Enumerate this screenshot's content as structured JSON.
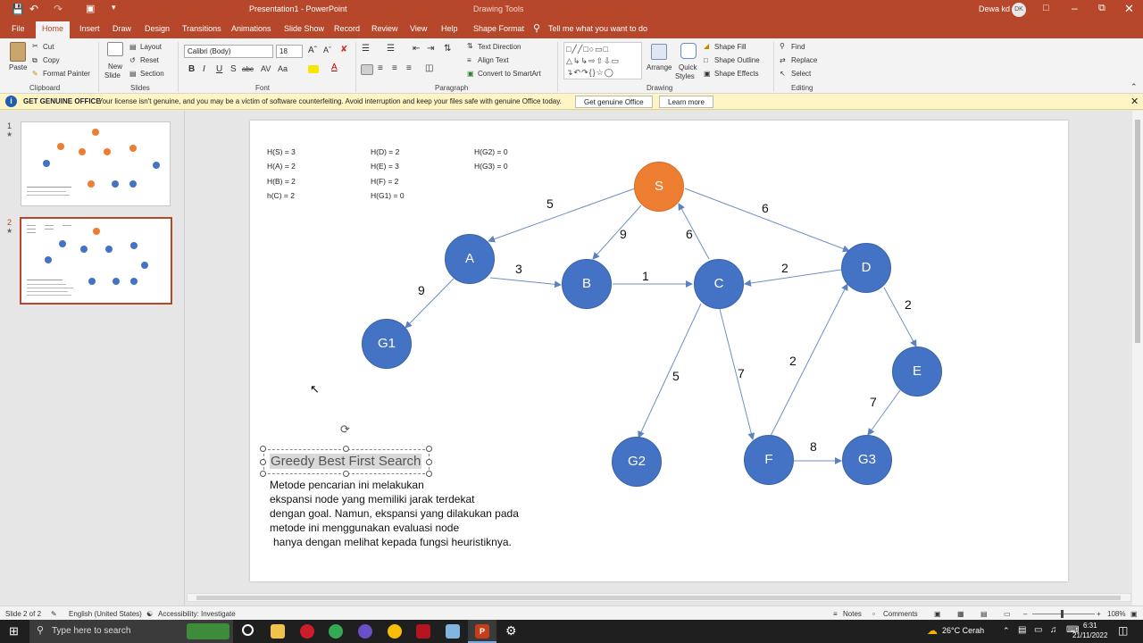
{
  "titlebar": {
    "title": "Presentation1  -  PowerPoint",
    "context": "Drawing Tools",
    "user": "Dewa kd",
    "initials": "DK"
  },
  "tabs": [
    "File",
    "Home",
    "Insert",
    "Draw",
    "Design",
    "Transitions",
    "Animations",
    "Slide Show",
    "Record",
    "Review",
    "View",
    "Help",
    "Shape Format"
  ],
  "tellme": "Tell me what you want to do",
  "ribbon": {
    "clipboard": {
      "paste": "Paste",
      "cut": "Cut",
      "copy": "Copy",
      "format_painter": "Format Painter",
      "label": "Clipboard"
    },
    "slides": {
      "new_slide": "New",
      "new_slide2": "Slide",
      "layout": "Layout",
      "reset": "Reset",
      "section": "Section",
      "label": "Slides"
    },
    "font": {
      "name": "Calibri (Body)",
      "size": "18",
      "label": "Font"
    },
    "paragraph": {
      "text_direction": "Text Direction",
      "align_text": "Align Text",
      "smartart": "Convert to SmartArt",
      "label": "Paragraph"
    },
    "drawing": {
      "arrange": "Arrange",
      "quick_styles": "Quick",
      "quick_styles2": "Styles",
      "shape_fill": "Shape Fill",
      "shape_outline": "Shape Outline",
      "shape_effects": "Shape Effects",
      "label": "Drawing"
    },
    "editing": {
      "find": "Find",
      "replace": "Replace",
      "select": "Select",
      "label": "Editing"
    }
  },
  "banner": {
    "title": "GET GENUINE OFFICE",
    "message": "Your license isn't genuine, and you may be a victim of software counterfeiting. Avoid interruption and keep your files safe with genuine Office today.",
    "btn1": "Get genuine Office",
    "btn2": "Learn more"
  },
  "thumbnails": [
    {
      "num": "1"
    },
    {
      "num": "2"
    }
  ],
  "slide": {
    "heuristics": [
      "H(S) = 3",
      "H(A) = 2",
      "H(B) = 2",
      "h(C) = 2",
      "H(D) = 2",
      "H(E) = 3",
      "H(F) = 2",
      "H(G1) = 0",
      "H(G2) = 0",
      "H(G3) = 0"
    ],
    "nodes": {
      "S": "S",
      "A": "A",
      "B": "B",
      "C": "C",
      "D": "D",
      "E": "E",
      "F": "F",
      "G1": "G1",
      "G2": "G2",
      "G3": "G3"
    },
    "weights": {
      "SA": "5",
      "SB": "9",
      "CS": "6",
      "SD": "6",
      "AB": "3",
      "AG1": "9",
      "BC": "1",
      "DC": "2",
      "DE": "2",
      "CG2": "5",
      "CF": "7",
      "FD": "2",
      "EG3": "7",
      "FG3": "8"
    },
    "title": "Greedy Best First Search",
    "description": [
      "Metode pencarian ini melakukan",
      "ekspansi node yang memiliki jarak terdekat",
      "dengan goal. Namun, ekspansi yang dilakukan pada",
      "metode ini menggunakan evaluasi node",
      "hanya dengan melihat kepada fungsi heuristiknya."
    ]
  },
  "status": {
    "slide": "Slide 2 of 2",
    "language": "English (United States)",
    "accessibility": "Accessibility: Investigate",
    "notes": "Notes",
    "comments": "Comments",
    "zoom": "108%"
  },
  "taskbar": {
    "search": "Type here to search",
    "weather": "26°C  Cerah",
    "time": "6:31",
    "date": "21/11/2022"
  }
}
